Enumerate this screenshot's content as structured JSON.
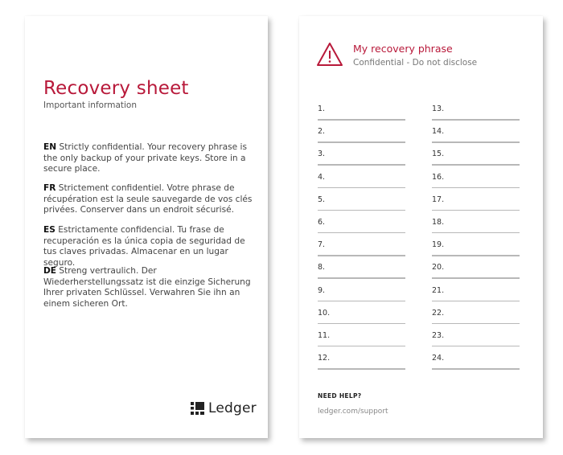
{
  "left_card": {
    "title": "Recovery sheet",
    "subtitle": "Important information",
    "paragraphs": [
      {
        "lang": "EN",
        "text": " Strictly confidential. Your recovery phrase is the only backup of your private keys. Store in a secure place."
      },
      {
        "lang": "FR",
        "text": " Strictement confidentiel. Votre phrase de récupération est la seule sauvegarde de vos clés privées. Conserver dans un endroit sécurisé."
      },
      {
        "lang": "ES",
        "text": " Estrictamente confidencial. Tu frase de recuperación es la única copia de seguridad de tus claves privadas. Almacenar en un lugar seguro."
      },
      {
        "lang": "DE",
        "text": " Streng vertraulich. Der Wiederherstellungssatz ist die einzige Sicherung Ihrer privaten Schlüssel. Verwahren Sie ihn an einem sicheren Ort."
      }
    ],
    "logo": {
      "icon": "ledger-logo-icon",
      "text": "Ledger"
    }
  },
  "right_card": {
    "icon": "warning-triangle-icon",
    "title": "My recovery phrase",
    "subtitle": "Confidential - Do not disclose",
    "words_left": [
      "1.",
      "2.",
      "3.",
      "4.",
      "5.",
      "6.",
      "7.",
      "8.",
      "9.",
      "10.",
      "11.",
      "12."
    ],
    "words_right": [
      "13.",
      "14.",
      "15.",
      "16.",
      "17.",
      "18.",
      "19.",
      "20.",
      "21.",
      "22.",
      "23.",
      "24."
    ],
    "help_label": "NEED HELP?",
    "help_link": "ledger.com/support"
  },
  "colors": {
    "accent": "#b8193a",
    "text": "#444444",
    "line": "#b8b8b8"
  }
}
